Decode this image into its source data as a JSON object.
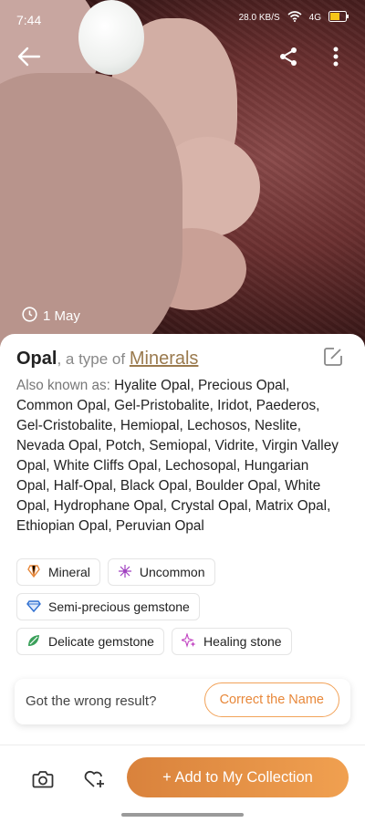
{
  "status_bar": {
    "time": "7:44",
    "network": "4G",
    "speed": "28.0 KB/S"
  },
  "photo": {
    "date": "1 May"
  },
  "result": {
    "name": "Opal",
    "type_prefix": ", a type of ",
    "category": "Minerals",
    "aka_label": "Also known as: ",
    "aka_list": "Hyalite Opal, Precious Opal, Common Opal, Gel-Pristobalite, Iridot, Paederos, Gel-Cristobalite, Hemiopal, Lechosos, Neslite, Nevada Opal, Potch, Semiopal, Vidrite, Virgin Valley Opal, White Cliffs Opal, Lechosopal, Hungarian Opal, Half-Opal, Black Opal, Boulder Opal, White Opal, Hydrophane Opal, Crystal Opal, Matrix Opal, Ethiopian Opal, Peruvian Opal"
  },
  "tags": [
    {
      "label": "Mineral",
      "icon": "mineral-icon",
      "color": "#e8883a"
    },
    {
      "label": "Uncommon",
      "icon": "sparkle-icon",
      "color": "#a040c0"
    },
    {
      "label": "Semi-precious gemstone",
      "icon": "diamond-icon",
      "color": "#2f6fd0"
    },
    {
      "label": "Delicate gemstone",
      "icon": "leaf-gem-icon",
      "color": "#3aa05a"
    },
    {
      "label": "Healing stone",
      "icon": "sparkles-icon",
      "color": "#c040c0"
    }
  ],
  "feedback": {
    "question": "Got the wrong result?",
    "button": "Correct the Name"
  },
  "bottom_bar": {
    "add_label": "+ Add to My Collection"
  },
  "colors": {
    "accent": "#e8883a",
    "category": "#9a7a4e"
  }
}
